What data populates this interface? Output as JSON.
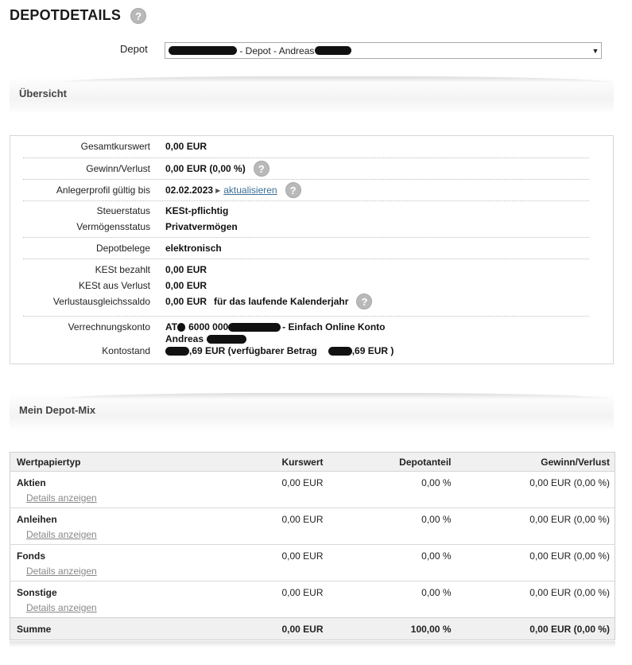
{
  "page": {
    "title": "DEPOTDETAILS",
    "help_icon": "question-icon"
  },
  "depot": {
    "label": "Depot",
    "selected_text": " - Depot - Andreas",
    "dropdown_icon": "triangle-down-icon"
  },
  "overview": {
    "title": "Übersicht",
    "rows": {
      "gesamtkurswert": {
        "label": "Gesamtkurswert",
        "value": "0,00 EUR"
      },
      "gewinn": {
        "label": "Gewinn/Verlust",
        "value": "0,00 EUR (0,00 %)"
      },
      "anlegerprofil": {
        "label": "Anlegerprofil gültig bis",
        "value": "02.02.2023",
        "link": "aktualisieren"
      },
      "steuerstatus": {
        "label": "Steuerstatus",
        "value": "KESt-pflichtig"
      },
      "vermoegensstatus": {
        "label": "Vermögensstatus",
        "value": "Privatvermögen"
      },
      "depotbelege": {
        "label": "Depotbelege",
        "value": "elektronisch"
      },
      "kest_bezahlt": {
        "label": "KESt bezahlt",
        "value": "0,00 EUR"
      },
      "kest_verlust": {
        "label": "KESt aus Verlust",
        "value": "0,00 EUR"
      },
      "verlustausgleich": {
        "label": "Verlustausgleichssaldo",
        "value": "0,00 EUR",
        "note": "für das laufende Kalenderjahr"
      },
      "verrechnungskonto": {
        "label": "Verrechnungskonto",
        "value_prefix": "AT",
        "value_mid": "6000 000",
        "value_suffix": "- Einfach Online Konto",
        "line2": "Andreas"
      },
      "kontostand": {
        "label": "Kontostand",
        "value_a": ",69 EUR (verfügbarer Betrag",
        "value_b": ",69 EUR )"
      }
    }
  },
  "mix": {
    "title": "Mein Depot-Mix",
    "headers": [
      "Wertpapiertyp",
      "Kurswert",
      "Depotanteil",
      "Gewinn/Verlust"
    ],
    "details_label": "Details anzeigen",
    "rows": [
      {
        "name": "Aktien",
        "kurswert": "0,00 EUR",
        "anteil": "0,00 %",
        "gewinn": "0,00 EUR (0,00 %)"
      },
      {
        "name": "Anleihen",
        "kurswert": "0,00 EUR",
        "anteil": "0,00 %",
        "gewinn": "0,00 EUR (0,00 %)"
      },
      {
        "name": "Fonds",
        "kurswert": "0,00 EUR",
        "anteil": "0,00 %",
        "gewinn": "0,00 EUR (0,00 %)"
      },
      {
        "name": "Sonstige",
        "kurswert": "0,00 EUR",
        "anteil": "0,00 %",
        "gewinn": "0,00 EUR (0,00 %)"
      }
    ],
    "sum": {
      "name": "Summe",
      "kurswert": "0,00 EUR",
      "anteil": "100,00 %",
      "gewinn": "0,00 EUR (0,00 %)"
    }
  }
}
